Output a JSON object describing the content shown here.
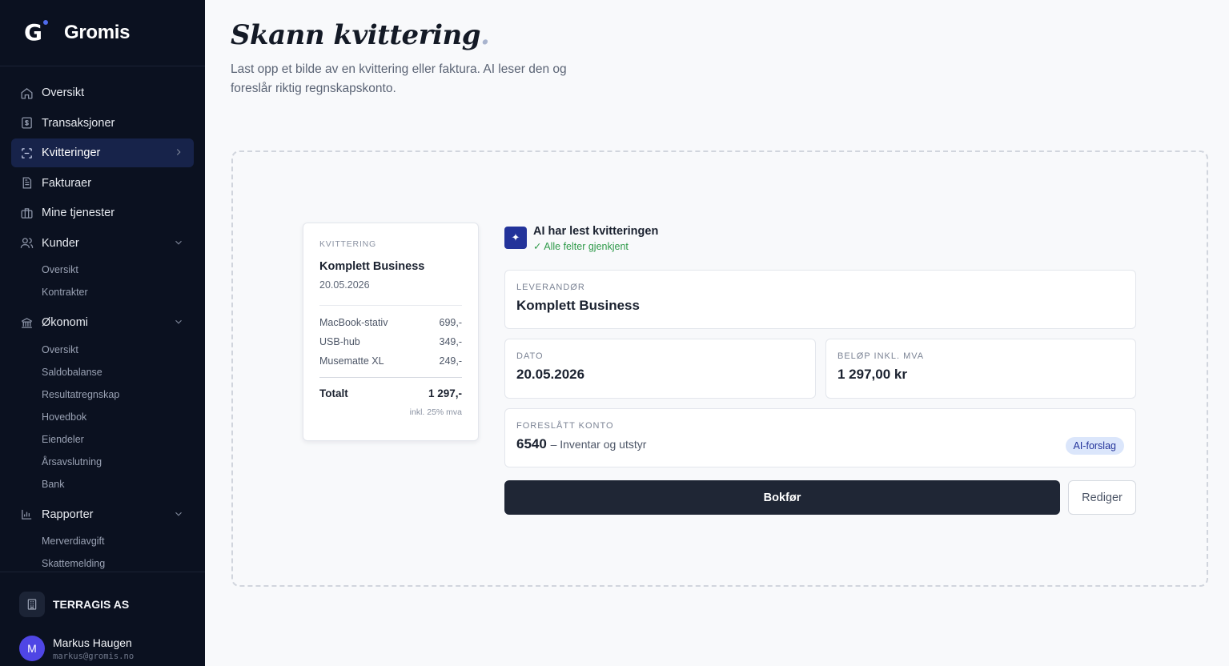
{
  "app": {
    "name": "Gromis",
    "logo_letter": "G"
  },
  "sidebar": {
    "items": [
      {
        "label": "Oversikt",
        "icon": "home-icon"
      },
      {
        "label": "Transaksjoner",
        "icon": "dollar-receipt-icon"
      },
      {
        "label": "Kvitteringer",
        "icon": "scan-icon",
        "active": true
      },
      {
        "label": "Fakturaer",
        "icon": "document-icon"
      },
      {
        "label": "Mine tjenester",
        "icon": "briefcase-icon"
      },
      {
        "label": "Kunder",
        "icon": "users-icon",
        "expanded": true,
        "children": [
          "Oversikt",
          "Kontrakter"
        ]
      },
      {
        "label": "Økonomi",
        "icon": "bank-icon",
        "expanded": true,
        "children": [
          "Oversikt",
          "Saldobalanse",
          "Resultatregnskap",
          "Hovedbok",
          "Eiendeler",
          "Årsavslutning",
          "Bank"
        ]
      },
      {
        "label": "Rapporter",
        "icon": "bar-chart-icon",
        "expanded": true,
        "children": [
          "Merverdiavgift",
          "Skattemelding"
        ]
      }
    ],
    "company": "TERRAGIS AS",
    "user": {
      "initial": "M",
      "name": "Markus Haugen",
      "email": "markus@gromis.no"
    }
  },
  "page": {
    "title": "Skann kvittering",
    "title_dot": ".",
    "subtitle": "Last opp et bilde av en kvittering eller faktura. AI leser den og foreslår riktig regnskapskonto."
  },
  "receipt": {
    "label": "KVITTERING",
    "vendor": "Komplett Business",
    "date": "20.05.2026",
    "lines": [
      {
        "name": "MacBook-stativ",
        "amount": "699,-"
      },
      {
        "name": "USB-hub",
        "amount": "349,-"
      },
      {
        "name": "Musematte XL",
        "amount": "249,-"
      }
    ],
    "total_label": "Totalt",
    "total": "1 297,-",
    "vat_note": "inkl. 25% mva"
  },
  "ai": {
    "badge": "✦",
    "title": "AI har lest kvitteringen",
    "status": "✓ Alle felter gjenkjent"
  },
  "fields": {
    "vendor": {
      "label": "LEVERANDØR",
      "value": "Komplett Business"
    },
    "date": {
      "label": "DATO",
      "value": "20.05.2026"
    },
    "amount": {
      "label": "BELØP INKL. MVA",
      "value": "1 297,00 kr"
    },
    "account": {
      "label": "FORESLÅTT KONTO",
      "number": "6540",
      "name": "– Inventar og utstyr",
      "tag": "AI-forslag"
    }
  },
  "actions": {
    "primary": "Bokfør",
    "secondary": "Rediger"
  },
  "colors": {
    "sidebar_bg": "#0b1120",
    "active_item": "#17234a",
    "primary_button": "#1f2635",
    "ai_badge": "#23339a",
    "success": "#2f9a4a"
  }
}
